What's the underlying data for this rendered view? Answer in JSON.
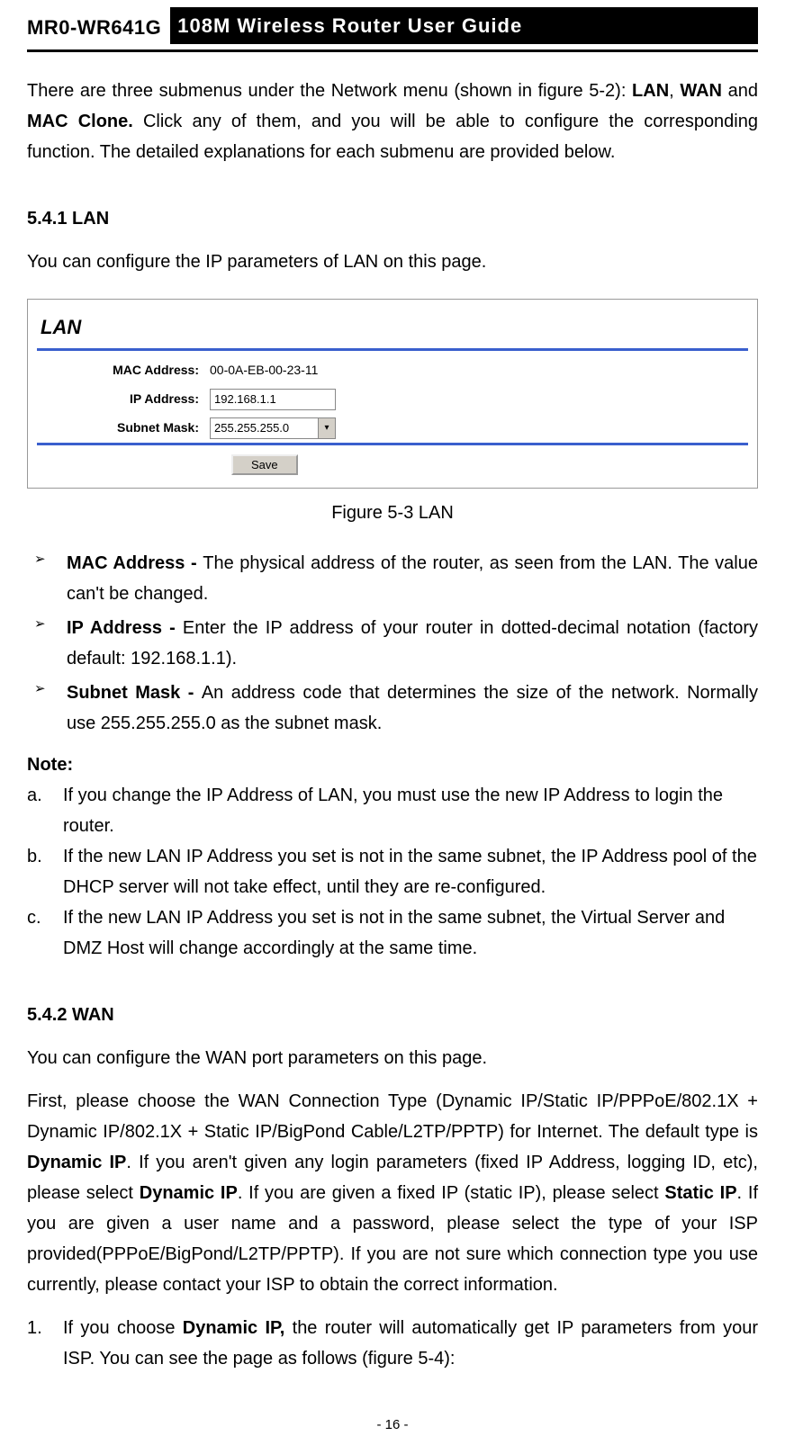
{
  "header": {
    "model": "MR0-WR641G",
    "title": "108M Wireless Router User Guide"
  },
  "intro": {
    "prefix": "There are three submenus under the Network menu (shown in figure 5-2): ",
    "m1": "LAN",
    "sep1": ", ",
    "m2": "WAN",
    "sep2": " and ",
    "m3": "MAC Clone.",
    "suffix": " Click any of them, and you will be able to configure the corresponding function. The detailed explanations for each submenu are provided below."
  },
  "s541": {
    "heading": "5.4.1 LAN",
    "desc": "You can configure the IP parameters of LAN on this page."
  },
  "lanbox": {
    "title": "LAN",
    "macLabel": "MAC Address:",
    "macValue": "00-0A-EB-00-23-11",
    "ipLabel": "IP Address:",
    "ipValue": "192.168.1.1",
    "maskLabel": "Subnet Mask:",
    "maskValue": "255.255.255.0",
    "saveLabel": "Save"
  },
  "figcap": "Figure 5-3    LAN",
  "bullets": {
    "b1_bold": "MAC Address - ",
    "b1_text": "The physical address of the router, as seen from the LAN. The value can't be changed.",
    "b2_bold": "IP Address - ",
    "b2_text": "Enter the IP address of your router in dotted-decimal notation (factory default: 192.168.1.1).",
    "b3_bold": "Subnet Mask - ",
    "b3_text": "An address code that determines the size of the network. Normally use 255.255.255.0 as the subnet mask."
  },
  "noteLabel": "Note:",
  "notes": {
    "a_m": "a.",
    "a_t": "If you change the IP Address of LAN, you must use the new IP Address to login the router.",
    "b_m": "b.",
    "b_t": "If the new LAN IP Address you set is not in the same subnet, the IP Address pool of the DHCP server will not take effect, until they are re-configured.",
    "c_m": "c.",
    "c_t": "If the new LAN IP Address you set is not in the same subnet, the Virtual Server and DMZ Host will change accordingly at the same time."
  },
  "s542": {
    "heading": "5.4.2 WAN",
    "desc": "You can configure the WAN port parameters on this page."
  },
  "wanPara": {
    "p1": "First, please choose the WAN Connection Type (Dynamic IP/Static IP/PPPoE/802.1X + Dynamic IP/802.1X + Static IP/BigPond Cable/L2TP/PPTP) for Internet. The default type is ",
    "b1": "Dynamic IP",
    "p2": ". If you aren't given any login parameters (fixed IP Address, logging ID, etc), please select ",
    "b2": "Dynamic IP",
    "p3": ". If you are given a fixed IP (static IP), please select ",
    "b3": "Static IP",
    "p4": ". If you are given a user name and a password, please select the type of your ISP provided(PPPoE/BigPond/L2TP/PPTP). If you are not sure which connection type you use currently, please contact your ISP to obtain the correct information."
  },
  "olist": {
    "m1": "1.",
    "t1a": "If you choose ",
    "t1b": "Dynamic IP,",
    "t1c": " the router will automatically get IP parameters from your ISP. You can see the page as follows (figure 5-4):"
  },
  "pageNum": "- 16 -"
}
